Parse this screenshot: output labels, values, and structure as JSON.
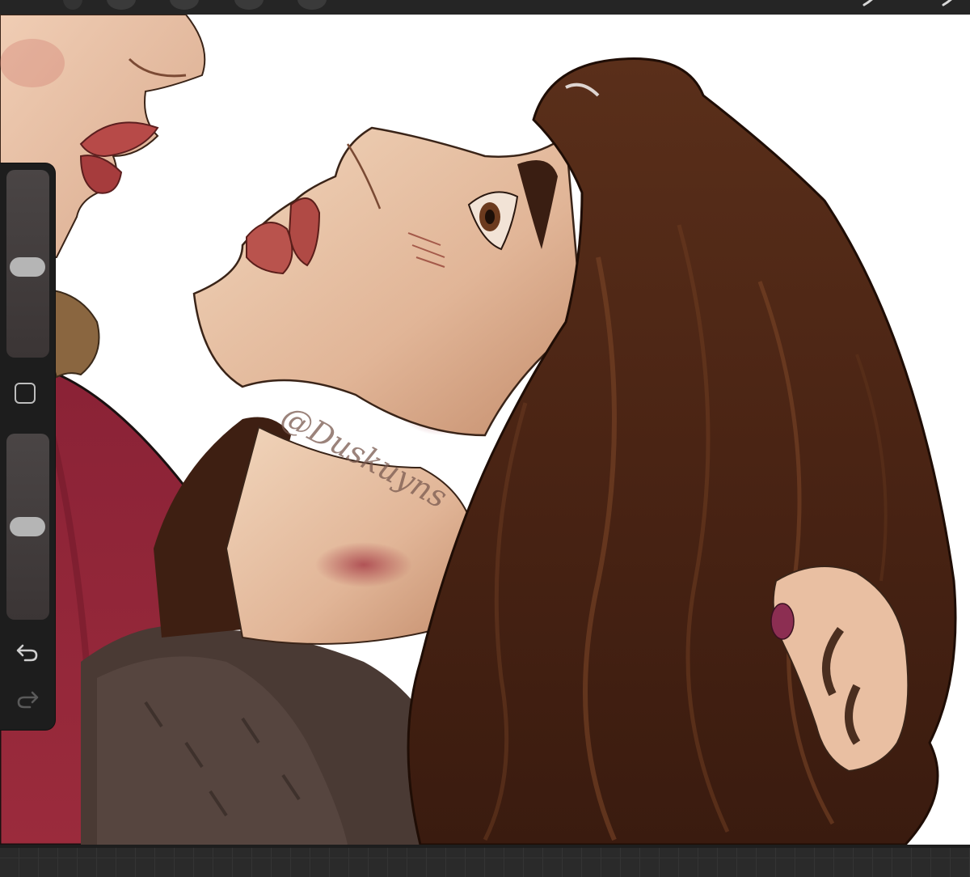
{
  "app": {
    "canvas_background": "#ffffff",
    "chrome_color": "#1d1d1d"
  },
  "toolbar": {
    "icons": [
      "brush-tool-icon",
      "smudge-tool-icon",
      "eraser-tool-icon",
      "layers-icon",
      "color-icon"
    ]
  },
  "sidebar": {
    "brush_size_level": 0.48,
    "opacity_level": 0.5,
    "modify_icon": "square-icon",
    "undo_icon": "undo-arrow-icon",
    "redo_icon": "redo-arrow-icon",
    "redo_enabled": false
  },
  "artwork": {
    "signature": "@Duskuyns"
  }
}
